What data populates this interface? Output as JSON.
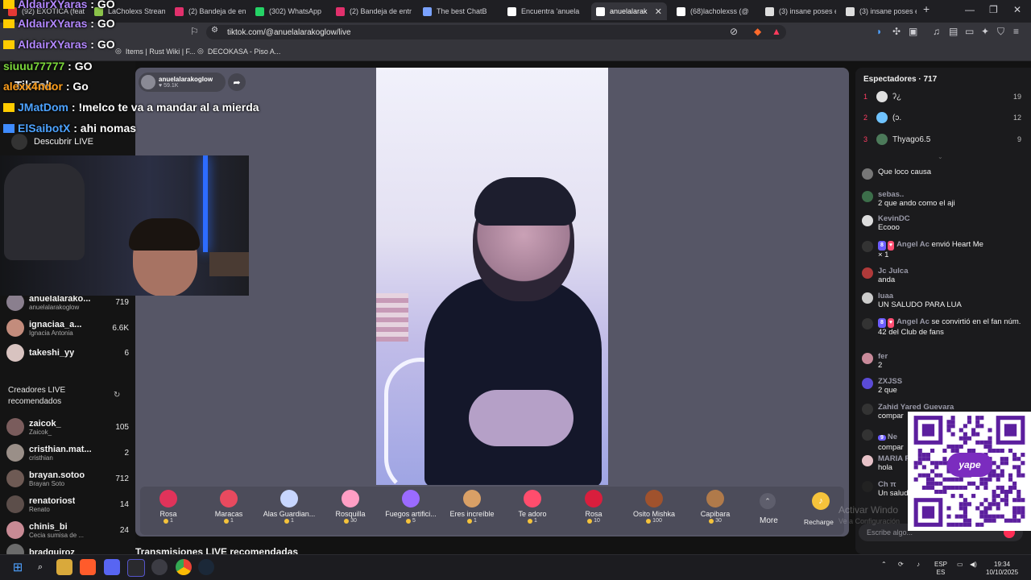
{
  "browser": {
    "tabs": [
      {
        "label": "(92) EXOTICA (feat.",
        "color": "#e53935"
      },
      {
        "label": "LaCholexs Stream -",
        "color": "#8bc34a"
      },
      {
        "label": "(2) Bandeja de entr",
        "color": "#e1306c"
      },
      {
        "label": "(302) WhatsApp",
        "color": "#25d366"
      },
      {
        "label": "(2) Bandeja de entr",
        "color": "#e1306c"
      },
      {
        "label": "The best ChatB",
        "color": "#7aa2ff"
      },
      {
        "label": "Encuentra 'anuela",
        "color": "#ffffff"
      },
      {
        "label": "anuelalarak",
        "color": "#ffffff",
        "active": true
      },
      {
        "label": "(68)lacholexss (@",
        "color": "#ffffff"
      },
      {
        "label": "(3) insane poses en",
        "color": "#dddddd"
      },
      {
        "label": "(3) insane poses en",
        "color": "#dddddd"
      }
    ],
    "new_tab": "+",
    "url": "tiktok.com/@anuelalarakoglow/live",
    "bookmarks": [
      "Items | Rust Wiki | F...",
      "DECOKASA - Piso A..."
    ]
  },
  "overlay_chat": [
    {
      "user": "AldairXYaras",
      "msg": ": GO",
      "color": "#b388ff",
      "badge": "#ffcc00"
    },
    {
      "user": "AldairXYaras",
      "msg": ": GO",
      "color": "#b388ff",
      "badge": "#ffcc00"
    },
    {
      "user": "AldairXYaras",
      "msg": ": GO",
      "color": "#b388ff",
      "badge": "#ffcc00"
    },
    {
      "user": "siuuu77777",
      "msg": ": GO",
      "color": "#7cd83b",
      "badge": ""
    },
    {
      "user": "alexx4ndor",
      "msg": ": Go",
      "color": "#ff9f1c",
      "badge": ""
    },
    {
      "user": "JMatDom",
      "msg": ": !melco te va a mandar al a mierda",
      "color": "#4da3ff",
      "badge": "#ffcc00"
    },
    {
      "user": "ElSaibotX",
      "msg": ": ahi nomas",
      "color": "#4da3ff",
      "badge": "#3f8cff"
    }
  ],
  "leftnav": {
    "logo": "TikTok",
    "descubrir": "Descubrir LIVE",
    "following": [
      {
        "name": "anuelalarako...",
        "sub": "anuelalarakoglow",
        "count": "719",
        "color": "#8a7f8e"
      },
      {
        "name": "ignaciaa_a...",
        "sub": "Ignacia Antonia",
        "count": "6.6K",
        "color": "#c38c7c"
      },
      {
        "name": "takeshi_yy",
        "sub": "",
        "count": "6",
        "color": "#d8c3c0"
      }
    ],
    "recom_title": "Creadores LIVE recomendados",
    "recommended": [
      {
        "name": "zaicok_",
        "sub": "Zaicok_",
        "count": "105",
        "color": "#7a5c5c"
      },
      {
        "name": "cristhian.mat...",
        "sub": "cristhian",
        "count": "2",
        "color": "#9a8f88"
      },
      {
        "name": "brayan.sotoo",
        "sub": "Brayan Soto",
        "count": "712",
        "color": "#6e5a54"
      },
      {
        "name": "renatoriost",
        "sub": "Renato",
        "count": "14",
        "color": "#5c4e4a"
      },
      {
        "name": "chinis_bi",
        "sub": "Cecia sumisa de ...",
        "count": "24",
        "color": "#c88a94"
      },
      {
        "name": "bradquiroz",
        "sub": "",
        "count": "",
        "color": "#6b6b6b"
      }
    ]
  },
  "host": {
    "name": "anuelalarakoglow",
    "likes": "59.1K"
  },
  "gifts": [
    {
      "name": "Rosa",
      "price": "1",
      "color": "#e0335a"
    },
    {
      "name": "Maracas",
      "price": "1",
      "color": "#e84a5f"
    },
    {
      "name": "Alas Guardian...",
      "price": "1",
      "color": "#c7d6ff"
    },
    {
      "name": "Rosquilla",
      "price": "30",
      "color": "#ff9ec4"
    },
    {
      "name": "Fuegos artifici...",
      "price": "5",
      "color": "#9b6bff"
    },
    {
      "name": "Eres increíble",
      "price": "1",
      "color": "#d9a066"
    },
    {
      "name": "Te adoro",
      "price": "1",
      "color": "#ff4d6d"
    },
    {
      "name": "Rosa",
      "price": "10",
      "color": "#d91e3d"
    },
    {
      "name": "Osito Mishka",
      "price": "100",
      "color": "#a0522d"
    },
    {
      "name": "Capibara",
      "price": "30",
      "color": "#b07a4a"
    }
  ],
  "more_label": "More",
  "recharge_label": "Recharge",
  "viewers": {
    "title": "Espectadores · 717",
    "list": [
      {
        "rank": "1",
        "name": "ʔ¿",
        "count": "19",
        "color": "#e0e0e0"
      },
      {
        "rank": "2",
        "name": "(ɔ.",
        "count": "12",
        "color": "#6fc3ff"
      },
      {
        "rank": "3",
        "name": "Thyago6.5",
        "count": "9",
        "color": "#4c7a5a"
      }
    ]
  },
  "chat": [
    {
      "user": "",
      "text": "Que loco causa",
      "color": "#777777"
    },
    {
      "user": "sebas..",
      "text": "2 que ando como el aji",
      "color": "#3c6e4a"
    },
    {
      "user": "KevinDC",
      "text": "Ecooo",
      "color": "#dddddd"
    },
    {
      "user": "Angel Ac",
      "level": "8",
      "text": "envió Heart Me",
      "extra": "× 1",
      "color": "#333333",
      "gift": true
    },
    {
      "user": "Jc Julca",
      "text": "anda",
      "color": "#b03a3a"
    },
    {
      "user": "luaa",
      "text": "UN SALUDO PARA LUA",
      "color": "#cccccc"
    },
    {
      "user": "Angel Ac",
      "level": "8",
      "text": "se convirtió en el fan núm. 42 del Club de fans",
      "color": "#333333",
      "gift": true
    },
    {
      "user": "fer",
      "text": "2",
      "color": "#c98a9a"
    },
    {
      "user": "ZXJSS",
      "text": "2 que",
      "color": "#5b4bd6"
    },
    {
      "user": "Zahid Yared Guevara",
      "text": "compar",
      "color": "#333333"
    },
    {
      "user": "Ne",
      "level": "9",
      "text": "compar",
      "color": "#333333"
    },
    {
      "user": "MARIA F",
      "text": "hola",
      "color": "#e7c2c8"
    },
    {
      "user": "Ch π",
      "text": "Un salud",
      "color": "#222222"
    }
  ],
  "chat_placeholder": "Escribe algo...",
  "qr_label": "yape",
  "watermark": "Activar Windo",
  "watermark_sub": "Ve a Configuración",
  "recom_live": "Transmisiones LIVE recomendadas",
  "taskbar": {
    "lang1": "ESP",
    "lang2": "ES",
    "time": "19:34",
    "date": "10/10/2025"
  }
}
